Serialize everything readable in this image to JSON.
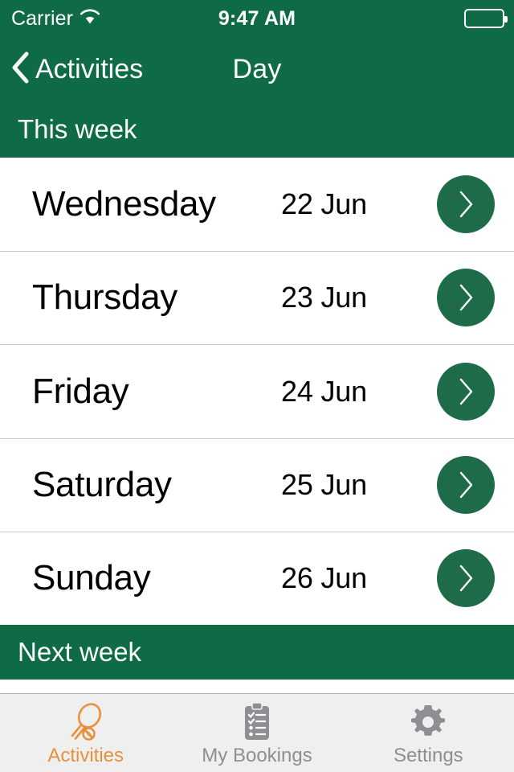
{
  "colors": {
    "brand_green": "#0e6b45",
    "button_green": "#1e6b4a",
    "accent_orange": "#e8913a",
    "tab_inactive": "#8e8e93",
    "tabbar_bg": "#efeff0",
    "separator": "#c8c7cc"
  },
  "status_bar": {
    "carrier": "Carrier",
    "wifi_icon": "wifi-icon",
    "time": "9:47 AM",
    "battery_icon": "battery-full-icon"
  },
  "nav_bar": {
    "back_icon": "chevron-left-icon",
    "back_label": "Activities",
    "title": "Day"
  },
  "sections": [
    {
      "label": "This week"
    },
    {
      "label": "Next week"
    }
  ],
  "days": [
    {
      "name": "Wednesday",
      "date": "22 Jun",
      "arrow_icon": "chevron-right-icon"
    },
    {
      "name": "Thursday",
      "date": "23 Jun",
      "arrow_icon": "chevron-right-icon"
    },
    {
      "name": "Friday",
      "date": "24 Jun",
      "arrow_icon": "chevron-right-icon"
    },
    {
      "name": "Saturday",
      "date": "25 Jun",
      "arrow_icon": "chevron-right-icon"
    },
    {
      "name": "Sunday",
      "date": "26 Jun",
      "arrow_icon": "chevron-right-icon"
    }
  ],
  "tab_bar": {
    "items": [
      {
        "label": "Activities",
        "icon": "tennis-racket-icon",
        "active": true
      },
      {
        "label": "My Bookings",
        "icon": "clipboard-checklist-icon",
        "active": false
      },
      {
        "label": "Settings",
        "icon": "gear-icon",
        "active": false
      }
    ]
  }
}
